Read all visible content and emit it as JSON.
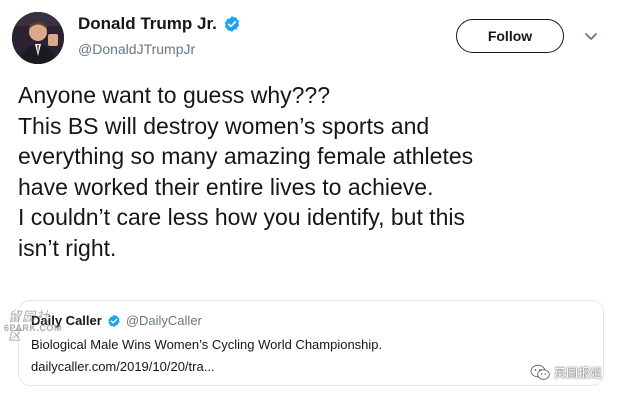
{
  "author": {
    "display_name": "Donald Trump Jr.",
    "handle": "@DonaldJTrumpJr",
    "verified": true
  },
  "actions": {
    "follow_label": "Follow"
  },
  "tweet": {
    "lines": [
      "Anyone want to guess why???",
      "This BS will destroy women’s sports and",
      "everything so many amazing female athletes",
      "have worked their entire lives to achieve.",
      "I couldn’t care less how you identify, but this",
      "isn’t right."
    ]
  },
  "quoted_tweet": {
    "display_name": "Daily Caller",
    "handle": "@DailyCaller",
    "verified": true,
    "text": "Biological Male Wins Women’s Cycling World Championship.",
    "link": "dailycaller.com/2019/10/20/tra..."
  },
  "watermarks": {
    "forum_glyphs": "留园社区",
    "forum_sub": "6PARK.COM",
    "wechat_account": "英国报姐"
  },
  "colors": {
    "verified_blue": "#1da1f2",
    "text_primary": "#14171a",
    "text_secondary": "#657786",
    "card_border": "#e1e8ed"
  }
}
